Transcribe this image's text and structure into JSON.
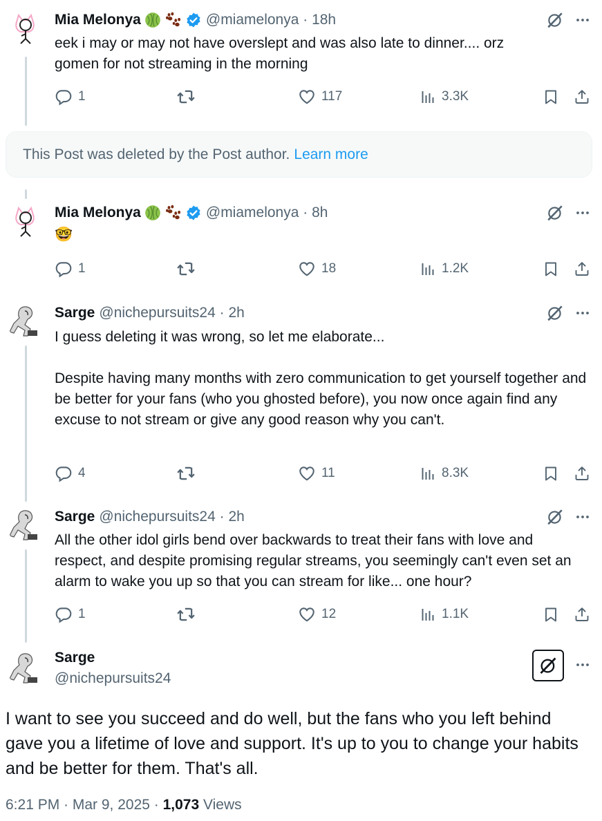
{
  "tweets": [
    {
      "name": "Mia Melonya",
      "handle": "@miamelonya · 18h",
      "text": "eek i may or may not have overslept and was also late to dinner.... orz\ngomen for not streaming in the morning",
      "replies": "1",
      "retweets": "",
      "likes": "117",
      "views": "3.3K"
    },
    {
      "name": "Mia Melonya",
      "handle": "@miamelonya · 8h",
      "text": "🤓",
      "replies": "1",
      "retweets": "",
      "likes": "18",
      "views": "1.2K"
    },
    {
      "name": "Sarge",
      "handle": "@nichepursuits24 · 2h",
      "text": "I guess deleting it was wrong, so let me elaborate...\n\nDespite having many months with zero communication to get yourself together and be better for your fans (who you ghosted before), you now once again find any excuse to not stream or give any good reason why you can't.",
      "replies": "4",
      "retweets": "",
      "likes": "11",
      "views": "8.3K"
    },
    {
      "name": "Sarge",
      "handle": "@nichepursuits24 · 2h",
      "text": "All the other idol girls bend over backwards to treat their fans with love and respect, and despite promising regular streams, you seemingly can't even set an alarm to wake you up so that you can stream for like... one hour?",
      "replies": "1",
      "retweets": "",
      "likes": "12",
      "views": "1.1K"
    }
  ],
  "deleted_notice": {
    "text": "This Post was deleted by the Post author.",
    "link": "Learn more"
  },
  "main_post": {
    "name": "Sarge",
    "handle": "@nichepursuits24",
    "text": "I want to see you succeed and do well, but the fans who you left behind gave you a lifetime of love and support. It's up to you to change your habits and be better for them. That's all.",
    "time": "6:21 PM · Mar 9, 2025 · ",
    "views_count": "1,073",
    "views_label": " Views"
  },
  "icons": {
    "reply": "reply-icon",
    "retweet": "retweet-icon",
    "like": "heart-icon",
    "views": "views-icon",
    "bookmark": "bookmark-icon",
    "share": "share-icon",
    "grok": "grok-icon",
    "more": "more-icon",
    "verified": "verified-badge-icon",
    "melon": "melon-emoji",
    "paw": "paw-prints-emoji"
  },
  "colors": {
    "accent": "#1d9bf0",
    "secondary_text": "#536471",
    "primary_text": "#0f1419"
  }
}
